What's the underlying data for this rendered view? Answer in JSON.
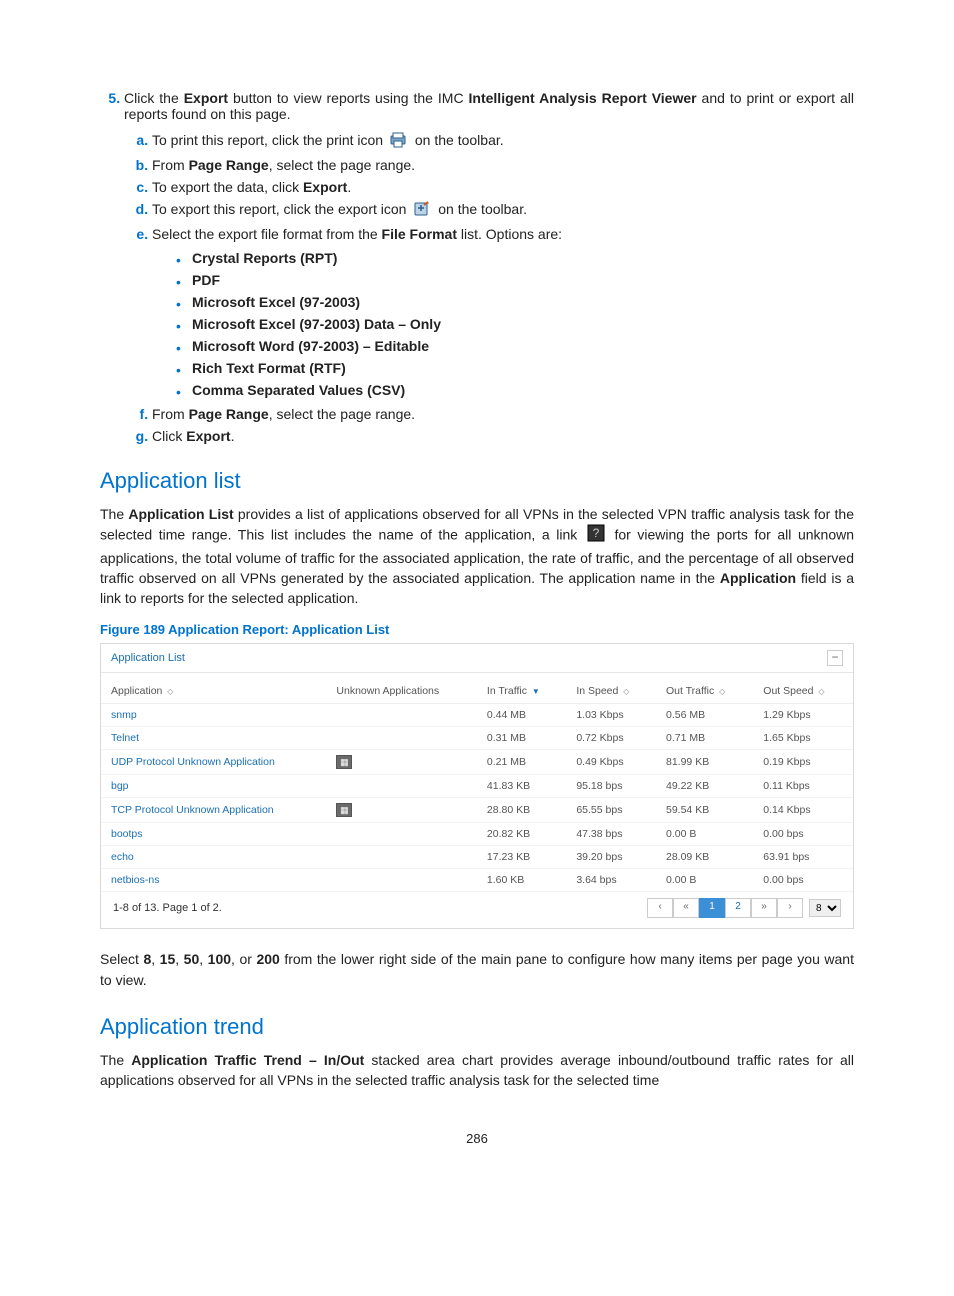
{
  "step5": {
    "num": "5.",
    "prefix": "Click the ",
    "b1": "Export",
    "mid1": " button to view reports using the IMC ",
    "b2": "Intelligent Analysis Report Viewer",
    "mid2": " and to print or export all reports found on this page.",
    "sub": {
      "a": {
        "before": "To print this report, click the print icon ",
        "after": " on the toolbar."
      },
      "b": {
        "before": "From ",
        "bold": "Page Range",
        "after": ", select the page range."
      },
      "c": {
        "before": "To export the data, click ",
        "bold": "Export",
        "after": "."
      },
      "d": {
        "before": "To export this report, click the export icon ",
        "after": " on the toolbar."
      },
      "e": {
        "before": "Select the export file format from the ",
        "bold": "File Format",
        "after": " list. Options are:"
      },
      "f": {
        "before": "From ",
        "bold": "Page Range",
        "after": ", select the page range."
      },
      "g": {
        "before": "Click ",
        "bold": "Export",
        "after": "."
      }
    },
    "formats": [
      "Crystal Reports (RPT)",
      "PDF",
      "Microsoft Excel (97-2003)",
      "Microsoft Excel (97-2003) Data – Only",
      "Microsoft Word (97-2003) – Editable",
      "Rich Text Format (RTF)",
      "Comma Separated Values (CSV)"
    ]
  },
  "applist": {
    "heading": "Application list",
    "p1": {
      "t1": "The ",
      "b1": "Application List",
      "t2": " provides a list of applications observed for all VPNs in the selected VPN traffic analysis task for the selected time range. This list includes the name of the application, a link ",
      "t3": " for viewing the ports for all unknown applications, the total volume of traffic for the associated application, the rate of traffic, and the percentage of all observed traffic observed on all VPNs generated by the associated application. The application name in the ",
      "b2": "Application",
      "t4": " field is a link to reports for the selected application."
    },
    "figcap": "Figure 189 Application Report: Application List",
    "panel_title": "Application List",
    "headers": {
      "app": "Application",
      "unknown": "Unknown Applications",
      "in_traffic": "In Traffic",
      "in_speed": "In Speed",
      "out_traffic": "Out Traffic",
      "out_speed": "Out Speed"
    },
    "rows": [
      {
        "app": "snmp",
        "unknown": "",
        "in_traffic": "0.44 MB",
        "in_speed": "1.03 Kbps",
        "out_traffic": "0.56 MB",
        "out_speed": "1.29 Kbps"
      },
      {
        "app": "Telnet",
        "unknown": "",
        "in_traffic": "0.31 MB",
        "in_speed": "0.72 Kbps",
        "out_traffic": "0.71 MB",
        "out_speed": "1.65 Kbps"
      },
      {
        "app": "UDP Protocol Unknown Application",
        "unknown": "icon",
        "in_traffic": "0.21 MB",
        "in_speed": "0.49 Kbps",
        "out_traffic": "81.99 KB",
        "out_speed": "0.19 Kbps"
      },
      {
        "app": "bgp",
        "unknown": "",
        "in_traffic": "41.83 KB",
        "in_speed": "95.18 bps",
        "out_traffic": "49.22 KB",
        "out_speed": "0.11 Kbps"
      },
      {
        "app": "TCP Protocol Unknown Application",
        "unknown": "icon",
        "in_traffic": "28.80 KB",
        "in_speed": "65.55 bps",
        "out_traffic": "59.54 KB",
        "out_speed": "0.14 Kbps"
      },
      {
        "app": "bootps",
        "unknown": "",
        "in_traffic": "20.82 KB",
        "in_speed": "47.38 bps",
        "out_traffic": "0.00 B",
        "out_speed": "0.00 bps"
      },
      {
        "app": "echo",
        "unknown": "",
        "in_traffic": "17.23 KB",
        "in_speed": "39.20 bps",
        "out_traffic": "28.09 KB",
        "out_speed": "63.91 bps"
      },
      {
        "app": "netbios-ns",
        "unknown": "",
        "in_traffic": "1.60 KB",
        "in_speed": "3.64 bps",
        "out_traffic": "0.00 B",
        "out_speed": "0.00 bps"
      }
    ],
    "pager": {
      "status": "1-8 of 13. Page 1 of 2.",
      "buttons": [
        "‹",
        "«",
        "1",
        "2",
        "»",
        "›"
      ],
      "perpage": "8"
    },
    "footnote": {
      "t1": "Select ",
      "b1": "8",
      "c1": ", ",
      "b2": "15",
      "c2": ", ",
      "b3": "50",
      "c3": ", ",
      "b4": "100",
      "c4": ", or ",
      "b5": "200",
      "t2": " from the lower right side of the main pane to configure how many items per page you want to view."
    }
  },
  "apptrend": {
    "heading": "Application trend",
    "p": {
      "t1": "The ",
      "b1": "Application Traffic Trend – In/Out",
      "t2": " stacked area chart provides average inbound/outbound traffic rates for all applications observed for all VPNs in the selected traffic analysis task for the selected time"
    }
  },
  "page_number": "286"
}
